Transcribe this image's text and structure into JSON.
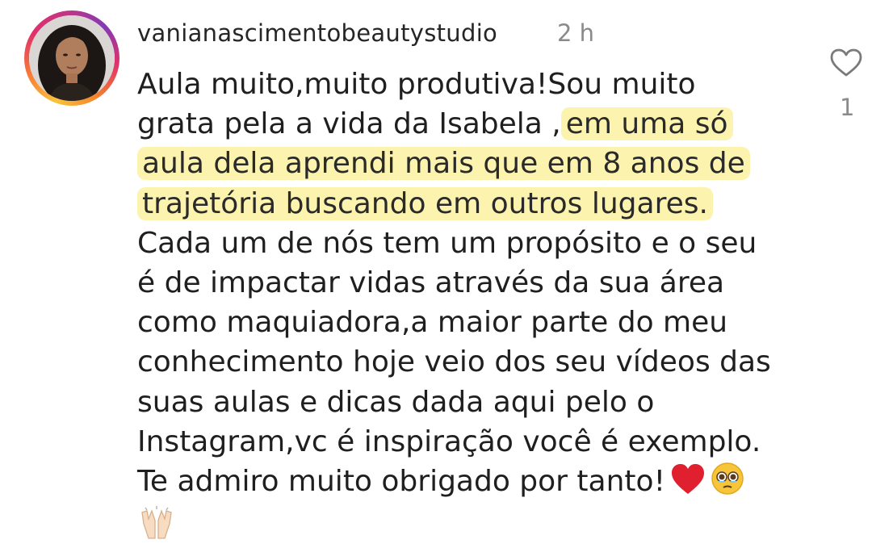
{
  "comment": {
    "username": "vanianascimentobeautystudio",
    "time": "2 h",
    "text_before": "Aula muito,muito  produtiva!Sou muito\ngrata pela a vida da Isabela ,",
    "highlighted_text": "em uma só\naula dela aprendi mais que em 8 anos de\ntrajetória buscando em outros lugares.",
    "text_after": "\nCada um de nós tem um propósito e o seu\né de impactar vidas através da sua área\ncomo maquiadora,a maior parte do meu\nconhecimento hoje veio dos seu vídeos das\nsuas aulas e dicas dada aqui pelo o\nInstagram,vc é inspiração você é exemplo.\nTe admiro muito obrigado por tanto!",
    "emojis": [
      "red-heart-emoji",
      "teary-face-emoji",
      "raised-hands-emoji"
    ],
    "like_count": "1"
  },
  "colors": {
    "highlight": "#faee82",
    "heart_emoji": "#e0202e",
    "muted_text": "#8a8a8a"
  }
}
